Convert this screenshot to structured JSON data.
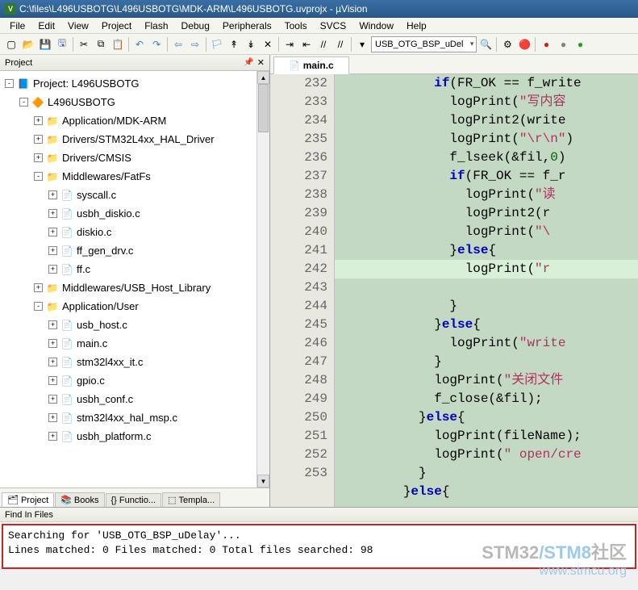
{
  "window": {
    "title": "C:\\files\\L496USBOTG\\L496USBOTG\\MDK-ARM\\L496USBOTG.uvprojx - µVision",
    "app_badge": "V"
  },
  "menu": [
    "File",
    "Edit",
    "View",
    "Project",
    "Flash",
    "Debug",
    "Peripherals",
    "Tools",
    "SVCS",
    "Window",
    "Help"
  ],
  "toolbar": {
    "combo_value": "USB_OTG_BSP_uDel"
  },
  "project_panel": {
    "title": "Project",
    "tabs": [
      {
        "label": "Project",
        "active": true
      },
      {
        "label": "Books",
        "active": false
      },
      {
        "label": "Functio...",
        "active": false
      },
      {
        "label": "Templa...",
        "active": false
      }
    ],
    "tree": [
      {
        "depth": 0,
        "toggle": "-",
        "icon": "prj",
        "label": "Project: L496USBOTG"
      },
      {
        "depth": 1,
        "toggle": "-",
        "icon": "target",
        "label": "L496USBOTG"
      },
      {
        "depth": 2,
        "toggle": "+",
        "icon": "folder",
        "label": "Application/MDK-ARM"
      },
      {
        "depth": 2,
        "toggle": "+",
        "icon": "folder",
        "label": "Drivers/STM32L4xx_HAL_Driver"
      },
      {
        "depth": 2,
        "toggle": "+",
        "icon": "folder",
        "label": "Drivers/CMSIS"
      },
      {
        "depth": 2,
        "toggle": "-",
        "icon": "folder",
        "label": "Middlewares/FatFs"
      },
      {
        "depth": 3,
        "toggle": "+",
        "icon": "file",
        "label": "syscall.c"
      },
      {
        "depth": 3,
        "toggle": "+",
        "icon": "file",
        "label": "usbh_diskio.c"
      },
      {
        "depth": 3,
        "toggle": "+",
        "icon": "file",
        "label": "diskio.c"
      },
      {
        "depth": 3,
        "toggle": "+",
        "icon": "file",
        "label": "ff_gen_drv.c"
      },
      {
        "depth": 3,
        "toggle": "+",
        "icon": "file",
        "label": "ff.c"
      },
      {
        "depth": 2,
        "toggle": "+",
        "icon": "folder",
        "label": "Middlewares/USB_Host_Library"
      },
      {
        "depth": 2,
        "toggle": "-",
        "icon": "folder",
        "label": "Application/User"
      },
      {
        "depth": 3,
        "toggle": "+",
        "icon": "file",
        "label": "usb_host.c"
      },
      {
        "depth": 3,
        "toggle": "+",
        "icon": "file",
        "label": "main.c"
      },
      {
        "depth": 3,
        "toggle": "+",
        "icon": "file",
        "label": "stm32l4xx_it.c"
      },
      {
        "depth": 3,
        "toggle": "+",
        "icon": "file",
        "label": "gpio.c"
      },
      {
        "depth": 3,
        "toggle": "+",
        "icon": "file",
        "label": "usbh_conf.c"
      },
      {
        "depth": 3,
        "toggle": "+",
        "icon": "file",
        "label": "stm32l4xx_hal_msp.c"
      },
      {
        "depth": 3,
        "toggle": "+",
        "icon": "file",
        "label": "usbh_platform.c"
      }
    ]
  },
  "editor": {
    "active_tab": "main.c",
    "first_line": 232,
    "lines": [
      {
        "indent": 12,
        "tokens": [
          {
            "t": "kw",
            "s": "if"
          },
          {
            "t": "",
            "s": "(FR_OK == f_write"
          }
        ]
      },
      {
        "indent": 14,
        "tokens": [
          {
            "t": "",
            "s": "logPrint("
          },
          {
            "t": "str",
            "s": "\"写内容"
          }
        ]
      },
      {
        "indent": 14,
        "tokens": [
          {
            "t": "",
            "s": "logPrint2(write"
          }
        ]
      },
      {
        "indent": 14,
        "tokens": [
          {
            "t": "",
            "s": "logPrint("
          },
          {
            "t": "str",
            "s": "\"\\r\\n\""
          },
          {
            "t": "",
            "s": ")"
          }
        ]
      },
      {
        "indent": 14,
        "tokens": [
          {
            "t": "",
            "s": "f_lseek(&fil,"
          },
          {
            "t": "num",
            "s": "0"
          },
          {
            "t": "",
            "s": ")"
          }
        ]
      },
      {
        "indent": 14,
        "tokens": [
          {
            "t": "kw",
            "s": "if"
          },
          {
            "t": "",
            "s": "(FR_OK == f_r"
          }
        ]
      },
      {
        "indent": 16,
        "tokens": [
          {
            "t": "",
            "s": "logPrint("
          },
          {
            "t": "str",
            "s": "\"读"
          }
        ]
      },
      {
        "indent": 16,
        "tokens": [
          {
            "t": "",
            "s": "logPrint2(r"
          }
        ]
      },
      {
        "indent": 16,
        "tokens": [
          {
            "t": "",
            "s": "logPrint("
          },
          {
            "t": "str",
            "s": "\"\\"
          }
        ]
      },
      {
        "indent": 14,
        "tokens": [
          {
            "t": "",
            "s": "}"
          },
          {
            "t": "kw",
            "s": "else"
          },
          {
            "t": "",
            "s": "{"
          }
        ]
      },
      {
        "indent": 16,
        "hl": true,
        "tokens": [
          {
            "t": "",
            "s": "logPrint("
          },
          {
            "t": "str",
            "s": "\"r"
          }
        ]
      },
      {
        "indent": 14,
        "tokens": [
          {
            "t": "",
            "s": "}"
          }
        ]
      },
      {
        "indent": 12,
        "tokens": [
          {
            "t": "",
            "s": "}"
          },
          {
            "t": "kw",
            "s": "else"
          },
          {
            "t": "",
            "s": "{"
          }
        ]
      },
      {
        "indent": 14,
        "tokens": [
          {
            "t": "",
            "s": "logPrint("
          },
          {
            "t": "str",
            "s": "\"write"
          }
        ]
      },
      {
        "indent": 12,
        "tokens": [
          {
            "t": "",
            "s": "}"
          }
        ]
      },
      {
        "indent": 12,
        "tokens": [
          {
            "t": "",
            "s": "logPrint("
          },
          {
            "t": "str",
            "s": "\"关闭文件"
          }
        ]
      },
      {
        "indent": 12,
        "tokens": [
          {
            "t": "",
            "s": "f_close(&fil);"
          }
        ]
      },
      {
        "indent": 10,
        "tokens": [
          {
            "t": "",
            "s": "}"
          },
          {
            "t": "kw",
            "s": "else"
          },
          {
            "t": "",
            "s": "{"
          }
        ]
      },
      {
        "indent": 12,
        "tokens": [
          {
            "t": "",
            "s": "logPrint(fileName);"
          }
        ]
      },
      {
        "indent": 12,
        "tokens": [
          {
            "t": "",
            "s": "logPrint("
          },
          {
            "t": "str",
            "s": "\" open/cre"
          }
        ]
      },
      {
        "indent": 10,
        "tokens": [
          {
            "t": "",
            "s": "}"
          }
        ]
      },
      {
        "indent": 8,
        "tokens": [
          {
            "t": "",
            "s": "}"
          },
          {
            "t": "kw",
            "s": "else"
          },
          {
            "t": "",
            "s": "{"
          }
        ]
      }
    ]
  },
  "find": {
    "title": "Find In Files",
    "line1": "Searching for 'USB_OTG_BSP_uDelay'...",
    "line2": "Lines matched: 0      Files matched: 0       Total files searched: 98"
  },
  "watermark": {
    "line1a": "STM32",
    "line1b": "/STM8",
    "line1c": "社区",
    "line2": "www.stmcu.org"
  }
}
